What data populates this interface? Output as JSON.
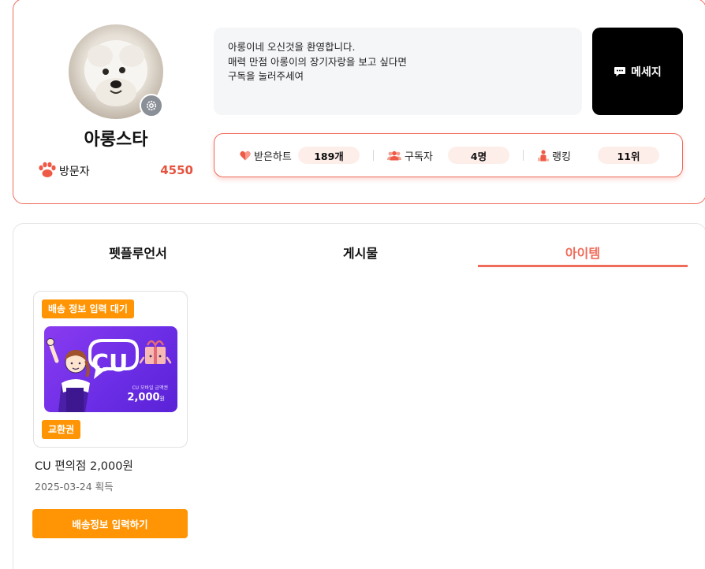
{
  "profile": {
    "nickname": "아롱스타",
    "visitor_label": "방문자",
    "visitor_count": "4550",
    "intro_lines": [
      "아롱이네 오신것을 환영합니다.",
      "매력 만점 아롱이의 장기자랑을 보고 싶다면",
      "구독을 눌러주세여"
    ],
    "message_label": "메세지",
    "stats": {
      "hearts_label": "받은하트",
      "hearts_value": "189개",
      "subscribers_label": "구독자",
      "subscribers_value": "4명",
      "ranking_label": "랭킹",
      "ranking_value": "11위"
    }
  },
  "tabs": [
    {
      "label": "펫플루언서",
      "active": false
    },
    {
      "label": "게시물",
      "active": false
    },
    {
      "label": "아이템",
      "active": true
    }
  ],
  "items": [
    {
      "status_badge": "배송 정보 입력 대기",
      "type_badge": "교환권",
      "image_brand": "CU",
      "image_caption": "CU 모바일 금액권",
      "image_amount": "2,000",
      "image_amount_unit": "원",
      "name": "CU 편의점 2,000원",
      "date": "2025-03-24 획득",
      "action_label": "배송정보 입력하기"
    }
  ],
  "colors": {
    "accent": "#ef6b5a",
    "orange": "#ff9505",
    "visitor_count": "#e6533f",
    "message_button": "#000000",
    "gift_card": "#7a35ee"
  },
  "icons": {
    "settings": "gear-icon",
    "visitor": "paw-icon",
    "message": "chat-bubble-icon",
    "hearts": "heart-icon",
    "subscribers": "people-icon",
    "ranking": "person-rank-icon"
  }
}
